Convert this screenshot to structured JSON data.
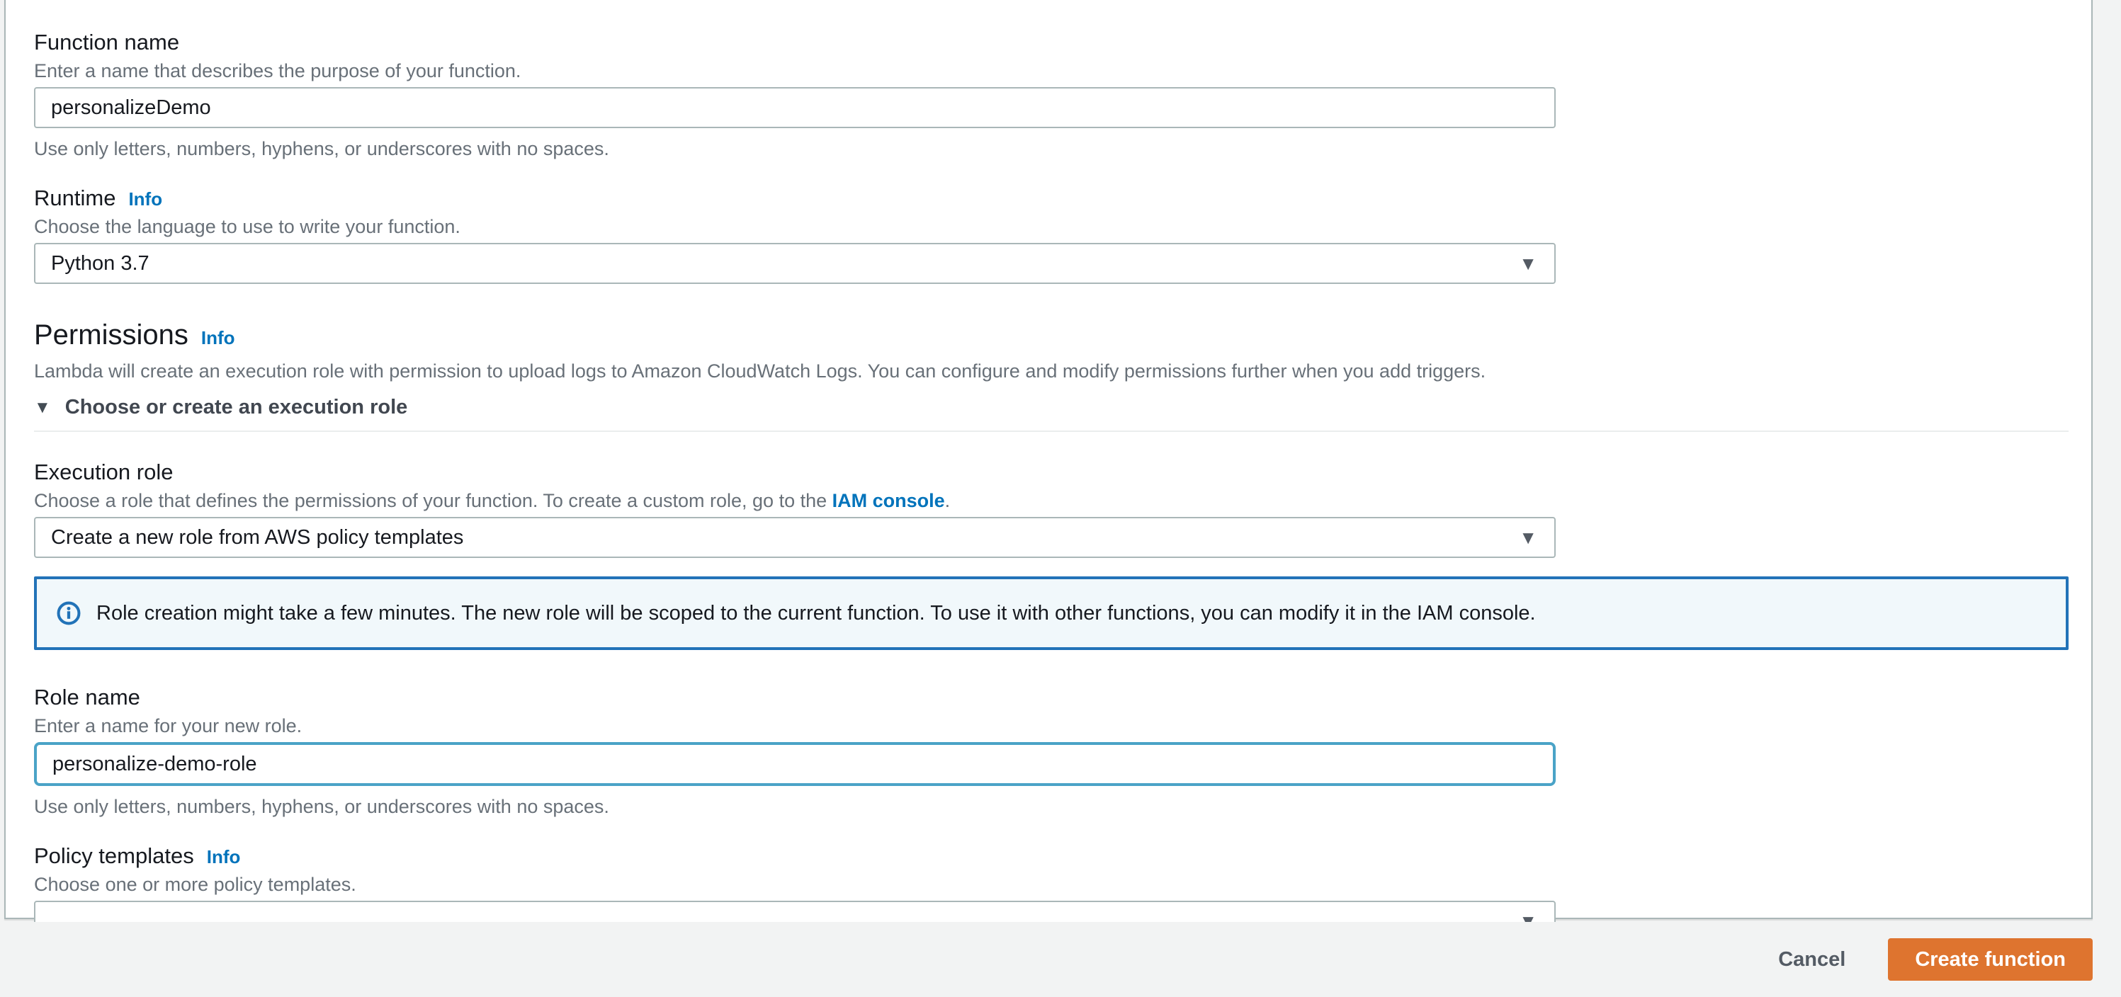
{
  "form": {
    "function_name": {
      "label": "Function name",
      "description": "Enter a name that describes the purpose of your function.",
      "value": "personalizeDemo",
      "helper": "Use only letters, numbers, hyphens, or underscores with no spaces."
    },
    "runtime": {
      "label": "Runtime",
      "info_label": "Info",
      "description": "Choose the language to use to write your function.",
      "value": "Python 3.7"
    },
    "permissions": {
      "heading": "Permissions",
      "info_label": "Info",
      "description": "Lambda will create an execution role with permission to upload logs to Amazon CloudWatch Logs. You can configure and modify permissions further when you add triggers.",
      "expander_label": "Choose or create an execution role"
    },
    "execution_role": {
      "label": "Execution role",
      "description_before_link": "Choose a role that defines the permissions of your function. To create a custom role, go to the ",
      "link_label": "IAM console",
      "description_after_link": ".",
      "value": "Create a new role from AWS policy templates"
    },
    "alert": {
      "text": "Role creation might take a few minutes. The new role will be scoped to the current function. To use it with other functions, you can modify it in the IAM console."
    },
    "role_name": {
      "label": "Role name",
      "description": "Enter a name for your new role.",
      "value": "personalize-demo-role",
      "helper": "Use only letters, numbers, hyphens, or underscores with no spaces."
    },
    "policy_templates": {
      "label": "Policy templates",
      "info_label": "Info",
      "description": "Choose one or more policy templates.",
      "value": ""
    }
  },
  "footer": {
    "cancel_label": "Cancel",
    "create_label": "Create function"
  },
  "colors": {
    "primary_button_orange": "#de742f",
    "link_blue": "#0073bb",
    "alert_border_blue": "#2273b8",
    "focus_border_blue": "#4aa3c7",
    "border_grey": "#aab7b8"
  }
}
